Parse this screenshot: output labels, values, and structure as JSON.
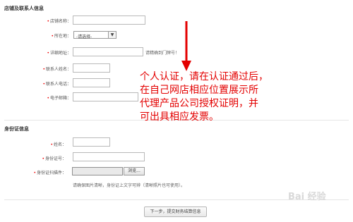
{
  "store_section": {
    "title": "店铺及联系人信息",
    "store_name_label": "店铺名称：",
    "location_label": "所在地：",
    "location_value": "-请选择-",
    "address_label": "详细地址：",
    "address_hint": "请精确到门牌号！",
    "contact_name_label": "联系人姓名：",
    "contact_phone_label": "联系人电话：",
    "email_label": "电子邮箱："
  },
  "id_section": {
    "title": "身份证信息",
    "name_label": "姓名：",
    "id_number_label": "身份证号：",
    "scan_label": "身份证扫描件：",
    "browse_label": "浏览...",
    "hint": "请确保图片清晰，身份证上文字可辨（清晰照片也可使用）。"
  },
  "next_button_label": "下一步，提交财务结算信息",
  "annotation": {
    "lines": [
      "个人认证，请在认证通过后，",
      "在自己网店相应位置展示所",
      "代理产品公司授权证明，并",
      "可出具相应发票。"
    ],
    "color": "#e30000"
  },
  "watermark": "Bai 经验"
}
